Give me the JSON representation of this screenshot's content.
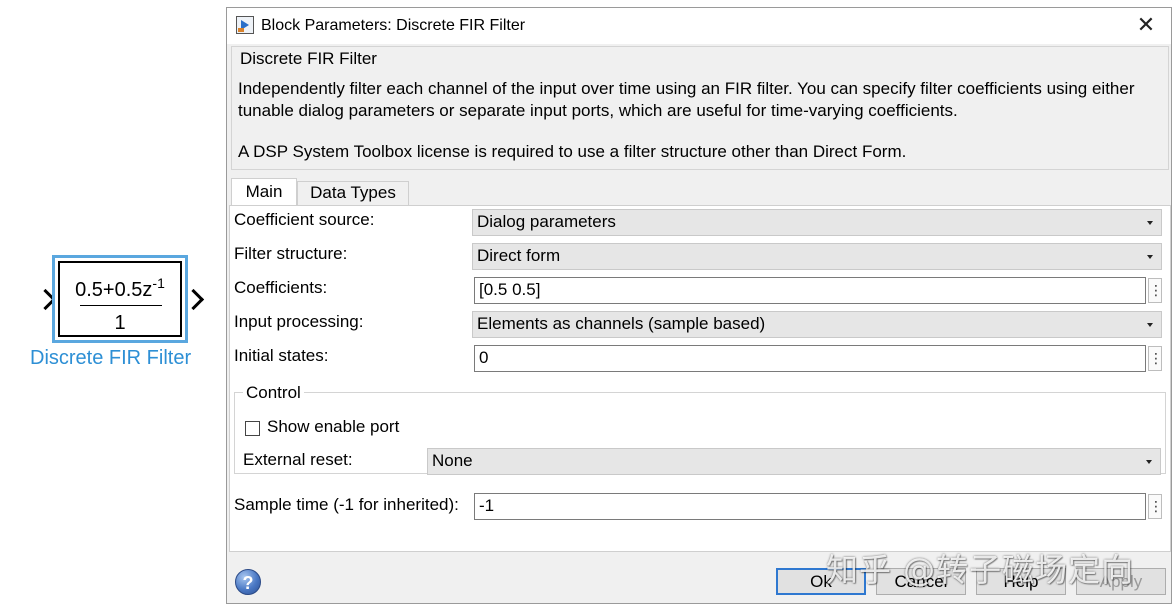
{
  "block": {
    "numerator_base": "0.5+0.5z",
    "numerator_exp": "-1",
    "denominator": "1",
    "label": "Discrete FIR Filter"
  },
  "dialog": {
    "title": "Block Parameters: Discrete FIR Filter",
    "close_glyph": "✕",
    "description": {
      "heading": "Discrete FIR Filter",
      "paragraph1": "Independently filter each channel of the input over time using an FIR filter. You can specify filter coefficients using either tunable dialog parameters or separate input ports, which are useful for time-varying coefficients.",
      "paragraph2": "A DSP System Toolbox license is required to use a filter structure other than Direct Form."
    },
    "tabs": [
      {
        "label": "Main",
        "active": true
      },
      {
        "label": "Data Types",
        "active": false
      }
    ],
    "fields": {
      "coefficient_source": {
        "label": "Coefficient source:",
        "value": "Dialog parameters"
      },
      "filter_structure": {
        "label": "Filter structure:",
        "value": "Direct form"
      },
      "coefficients": {
        "label": "Coefficients:",
        "value": "[0.5 0.5]"
      },
      "input_processing": {
        "label": "Input processing:",
        "value": "Elements as channels (sample based)"
      },
      "initial_states": {
        "label": "Initial states:",
        "value": "0"
      },
      "sample_time": {
        "label": "Sample time (-1 for inherited):",
        "value": "-1"
      }
    },
    "more_glyph": "⋮",
    "control": {
      "title": "Control",
      "show_enable_port": {
        "label": "Show enable port",
        "checked": false
      },
      "external_reset": {
        "label": "External reset:",
        "value": "None"
      }
    },
    "buttons": {
      "help_icon": "?",
      "ok": "Ok",
      "cancel": "Cancel",
      "help": "Help",
      "apply": "Apply"
    }
  },
  "watermark": "知乎 @转子磁场定向",
  "colors": {
    "block_highlight": "#5aa7df",
    "block_label": "#2d8fd5",
    "dialog_bg": "#f0f0f0",
    "ok_border": "#2f78d0"
  }
}
